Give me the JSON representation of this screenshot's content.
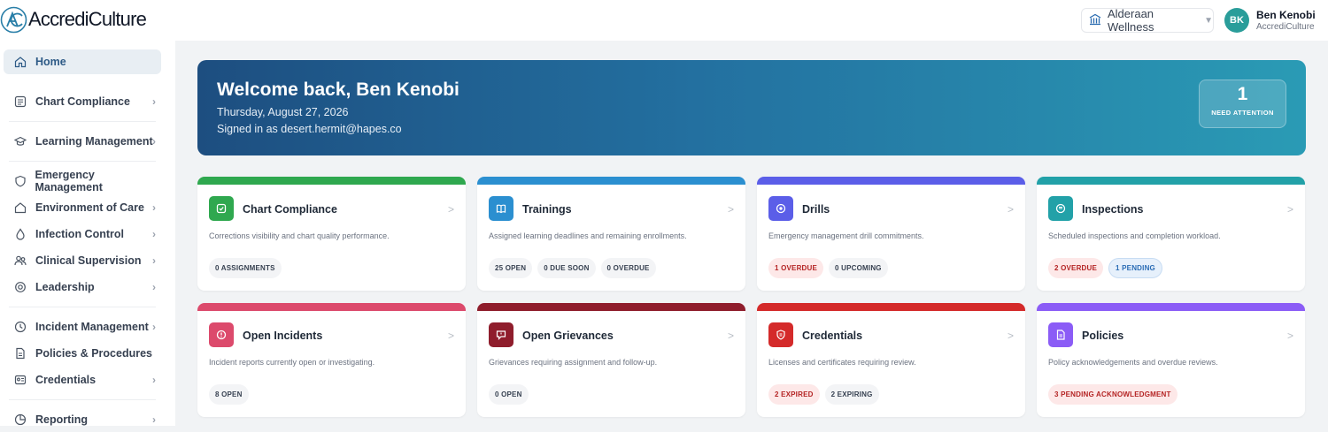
{
  "app": {
    "name": "AccrediCulture"
  },
  "header": {
    "org_name": "Alderaan Wellness",
    "user_initials": "BK",
    "user_name": "Ben Kenobi",
    "user_org": "AccrediCulture"
  },
  "sidebar": {
    "items": [
      {
        "label": "Home",
        "icon": "home-icon",
        "active": true
      },
      {
        "label": "Chart Compliance",
        "icon": "checklist-icon"
      },
      {
        "label": "Learning Management",
        "icon": "graduation-cap-icon"
      },
      {
        "label": "Emergency Management",
        "icon": "shield-icon"
      },
      {
        "label": "Environment of Care",
        "icon": "house-icon"
      },
      {
        "label": "Infection Control",
        "icon": "droplet-icon"
      },
      {
        "label": "Clinical Supervision",
        "icon": "users-icon"
      },
      {
        "label": "Leadership",
        "icon": "badge-icon"
      },
      {
        "label": "Incident Management",
        "icon": "clock-icon"
      },
      {
        "label": "Policies & Procedures",
        "icon": "document-icon"
      },
      {
        "label": "Credentials",
        "icon": "id-card-icon"
      },
      {
        "label": "Reporting",
        "icon": "chart-icon"
      }
    ]
  },
  "banner": {
    "title": "Welcome back, Ben Kenobi",
    "date": "Thursday, August 27, 2026",
    "signed_in": "Signed in as desert.hermit@hapes.co",
    "attention_count": "1",
    "attention_label": "NEED ATTENTION"
  },
  "cards": [
    {
      "title": "Chart Compliance",
      "desc": "Corrections visibility and chart quality performance.",
      "color": "#2fa84f",
      "icon": "chart-check-icon",
      "badges": [
        {
          "text": "0 ASSIGNMENTS",
          "tone": "neutral"
        }
      ]
    },
    {
      "title": "Trainings",
      "desc": "Assigned learning deadlines and remaining enrollments.",
      "color": "#2b8fd0",
      "icon": "book-icon",
      "badges": [
        {
          "text": "25 OPEN",
          "tone": "neutral"
        },
        {
          "text": "0 DUE SOON",
          "tone": "neutral"
        },
        {
          "text": "0 OVERDUE",
          "tone": "neutral"
        }
      ]
    },
    {
      "title": "Drills",
      "desc": "Emergency management drill commitments.",
      "color": "#5b5ee8",
      "icon": "target-icon",
      "badges": [
        {
          "text": "1 OVERDUE",
          "tone": "red"
        },
        {
          "text": "0 UPCOMING",
          "tone": "neutral"
        }
      ]
    },
    {
      "title": "Inspections",
      "desc": "Scheduled inspections and completion workload.",
      "color": "#22a1a8",
      "icon": "clipboard-icon",
      "badges": [
        {
          "text": "2 OVERDUE",
          "tone": "red"
        },
        {
          "text": "1 PENDING",
          "tone": "blue"
        }
      ]
    },
    {
      "title": "Open Incidents",
      "desc": "Incident reports currently open or investigating.",
      "color": "#dc4a6c",
      "icon": "alert-circle-icon",
      "badges": [
        {
          "text": "8 OPEN",
          "tone": "neutral"
        }
      ]
    },
    {
      "title": "Open Grievances",
      "desc": "Grievances requiring assignment and follow-up.",
      "color": "#8f1d2c",
      "icon": "message-icon",
      "badges": [
        {
          "text": "0 OPEN",
          "tone": "neutral"
        }
      ]
    },
    {
      "title": "Credentials",
      "desc": "Licenses and certificates requiring review.",
      "color": "#d42a2a",
      "icon": "certificate-icon",
      "badges": [
        {
          "text": "2 EXPIRED",
          "tone": "red"
        },
        {
          "text": "2 EXPIRING",
          "tone": "neutral"
        }
      ]
    },
    {
      "title": "Policies",
      "desc": "Policy acknowledgements and overdue reviews.",
      "color": "#8b5cf6",
      "icon": "file-icon",
      "badges": [
        {
          "text": "3 PENDING ACKNOWLEDGMENT",
          "tone": "red"
        }
      ]
    }
  ]
}
